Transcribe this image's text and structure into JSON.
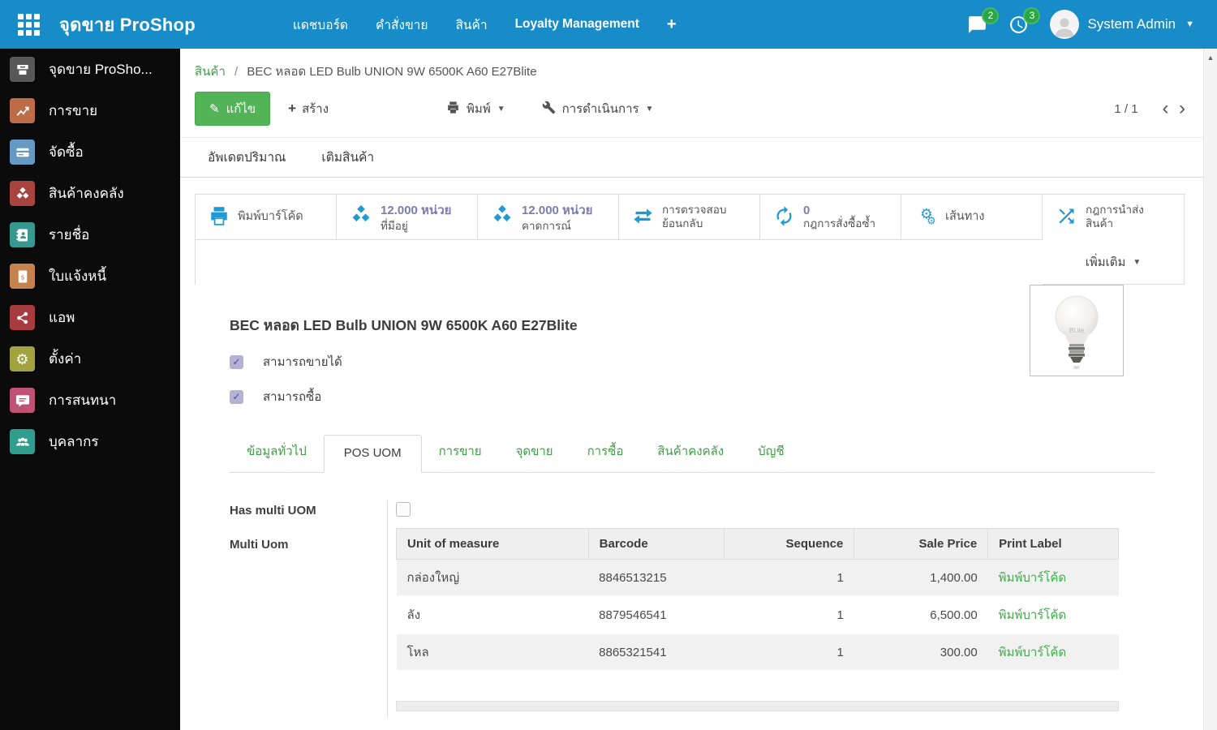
{
  "colors": {
    "topbar_blue": "#178cc8",
    "button_green": "#52b357",
    "link_green": "#3f9e45",
    "print_link_green": "#3daf49",
    "smart_icon_blue": "#1f9ad2",
    "stat_value_purple": "#7c7bad",
    "badge_green": "#28a745",
    "sidebar_bg": "#0b0b0b"
  },
  "topbar": {
    "app_title": "จุดขาย ProShop",
    "menus": [
      "แดชบอร์ด",
      "คำสั่งขาย",
      "สินค้า",
      "Loyalty Management"
    ],
    "add_menu": "+",
    "messages_badge": "2",
    "activities_badge": "3",
    "user_name": "System Admin"
  },
  "sidebar": {
    "items": [
      {
        "label": "จุดขาย ProSho..."
      },
      {
        "label": "การขาย"
      },
      {
        "label": "จัดซื้อ"
      },
      {
        "label": "สินค้าคงคลัง"
      },
      {
        "label": "รายชื่อ"
      },
      {
        "label": "ใบแจ้งหนี้"
      },
      {
        "label": "แอพ"
      },
      {
        "label": "ตั้งค่า"
      },
      {
        "label": "การสนทนา"
      },
      {
        "label": "บุคลากร"
      }
    ]
  },
  "breadcrumb": {
    "parent": "สินค้า",
    "separator": "/",
    "current": "BEC หลอด LED Bulb UNION 9W 6500K A60 E27Blite"
  },
  "toolbar": {
    "edit_label": "แก้ไข",
    "create_label": "สร้าง",
    "print_label": "พิมพ์",
    "action_label": "การดำเนินการ",
    "pager": "1 / 1",
    "prev": "‹",
    "next": "›"
  },
  "subtoolbar": {
    "update_qty_label": "อัพเดตปริมาณ",
    "replenish_label": "เติมสินค้า"
  },
  "smart_buttons": [
    {
      "label": "พิมพ์บาร์โค้ด"
    },
    {
      "value": "12.000 หน่วย",
      "label": "ที่มีอยู่"
    },
    {
      "value": "12.000 หน่วย",
      "label": "คาดการณ์"
    },
    {
      "label": "การตรวจสอบ",
      "label2": "ย้อนกลับ"
    },
    {
      "value": "0",
      "label": "กฎการสั่งซื้อซ้ำ"
    },
    {
      "label": "เส้นทาง"
    },
    {
      "label": "กฎการนำส่ง",
      "label2": "สินค้า"
    }
  ],
  "more_label": "เพิ่มเติม",
  "product": {
    "name": "BEC หลอด LED Bulb UNION 9W 6500K A60 E27Blite",
    "can_sold": "สามารถขายได้",
    "can_purchased": "สามารถซื้อ",
    "image_brand": "BLite"
  },
  "tabs": [
    "ข้อมูลทั่วไป",
    "POS UOM",
    "การขาย",
    "จุดขาย",
    "การซื้อ",
    "สินค้าคงคลัง",
    "บัญชี"
  ],
  "pos_uom": {
    "has_multi_label": "Has multi UOM",
    "multi_label": "Multi Uom",
    "headers": [
      "Unit of measure",
      "Barcode",
      "Sequence",
      "Sale Price",
      "Print Label"
    ],
    "rows": [
      {
        "uom": "กล่องใหญ่",
        "barcode": "8846513215",
        "sequence": "1",
        "price": "1,400.00",
        "print": "พิมพ์บาร์โค้ด"
      },
      {
        "uom": "ลัง",
        "barcode": "8879546541",
        "sequence": "1",
        "price": "6,500.00",
        "print": "พิมพ์บาร์โค้ด"
      },
      {
        "uom": "โหล",
        "barcode": "8865321541",
        "sequence": "1",
        "price": "300.00",
        "print": "พิมพ์บาร์โค้ด"
      }
    ]
  }
}
